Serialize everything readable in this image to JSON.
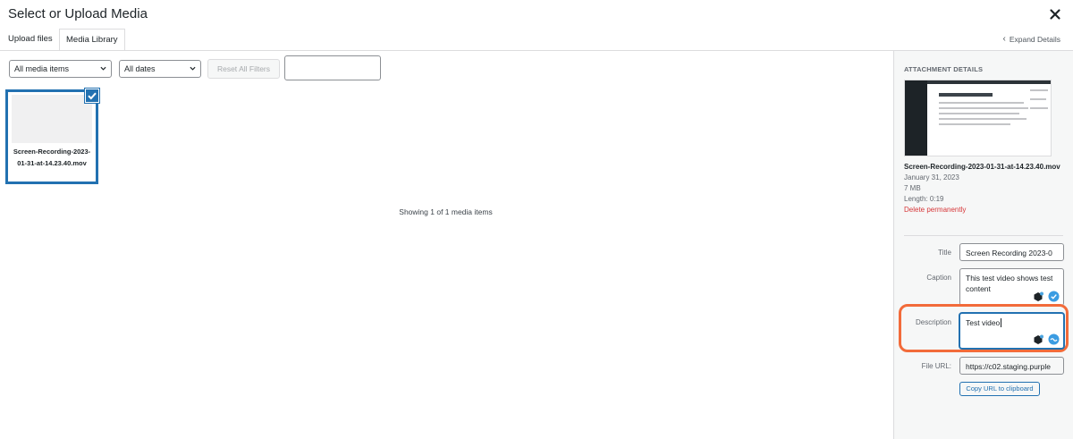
{
  "modal": {
    "title": "Select or Upload Media"
  },
  "tabs": {
    "upload": "Upload files",
    "library": "Media Library"
  },
  "header": {
    "expand_details": "Expand Details"
  },
  "filters": {
    "media_type": "All media items",
    "dates": "All dates",
    "reset": "Reset All Filters",
    "search_value": ""
  },
  "attachment": {
    "filename": "Screen-Recording-2023-01-31-at-14.23.40.mov",
    "selected": true
  },
  "status": {
    "showing": "Showing 1 of 1 media items"
  },
  "details": {
    "heading": "ATTACHMENT DETAILS",
    "filename": "Screen-Recording-2023-01-31-at-14.23.40.mov",
    "date": "January 31, 2023",
    "size": "7 MB",
    "length": "Length: 0:19",
    "delete": "Delete permanently",
    "title_label": "Title",
    "title_value": "Screen Recording 2023-0",
    "caption_label": "Caption",
    "caption_value": "This test video shows test content",
    "description_label": "Description",
    "description_value": "Test video",
    "url_label": "File URL:",
    "url_value": "https://c02.staging.purple",
    "copy_url": "Copy URL to clipboard"
  },
  "colors": {
    "accent": "#2271b1",
    "highlight": "#f26b3a",
    "danger": "#d63638"
  }
}
